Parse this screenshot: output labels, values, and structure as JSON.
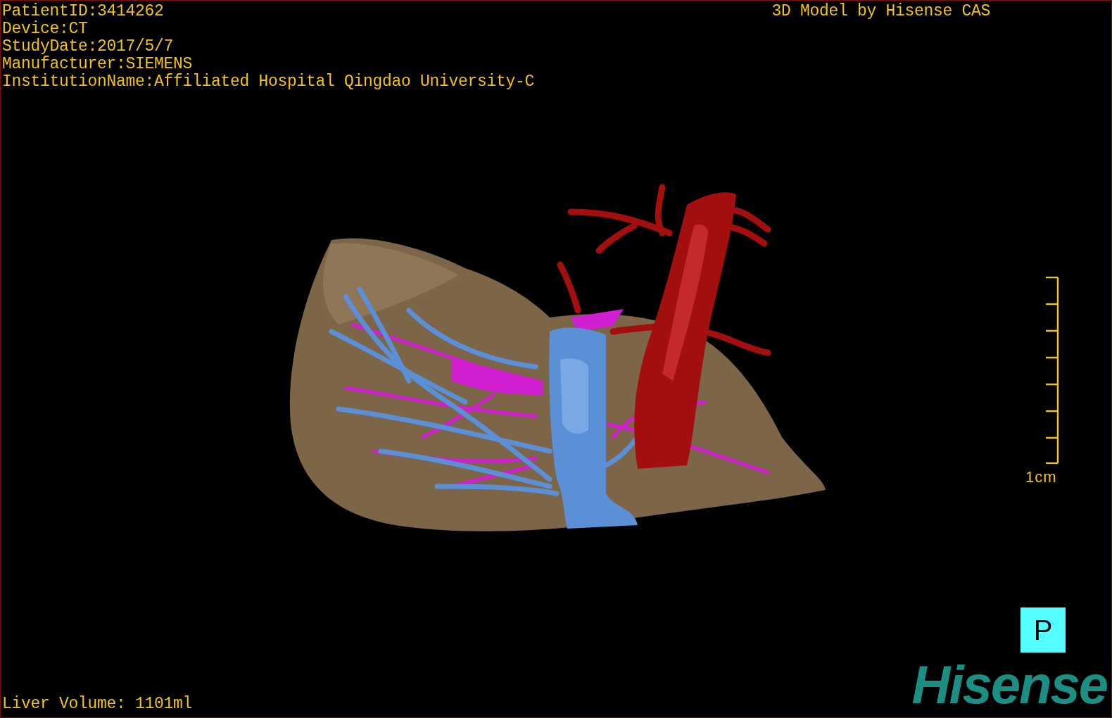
{
  "info_lines": [
    "PatientID:3414262",
    "Device:CT",
    "StudyDate:2017/5/7",
    "Manufacturer:SIEMENS",
    "InstitutionName:Affiliated Hospital Qingdao University-C"
  ],
  "credit": "3D Model by Hisense CAS",
  "scale_bar": {
    "label": "1cm"
  },
  "orientation": "P",
  "liver_volume": "Liver Volume: 1101ml",
  "logo": "Hisense"
}
